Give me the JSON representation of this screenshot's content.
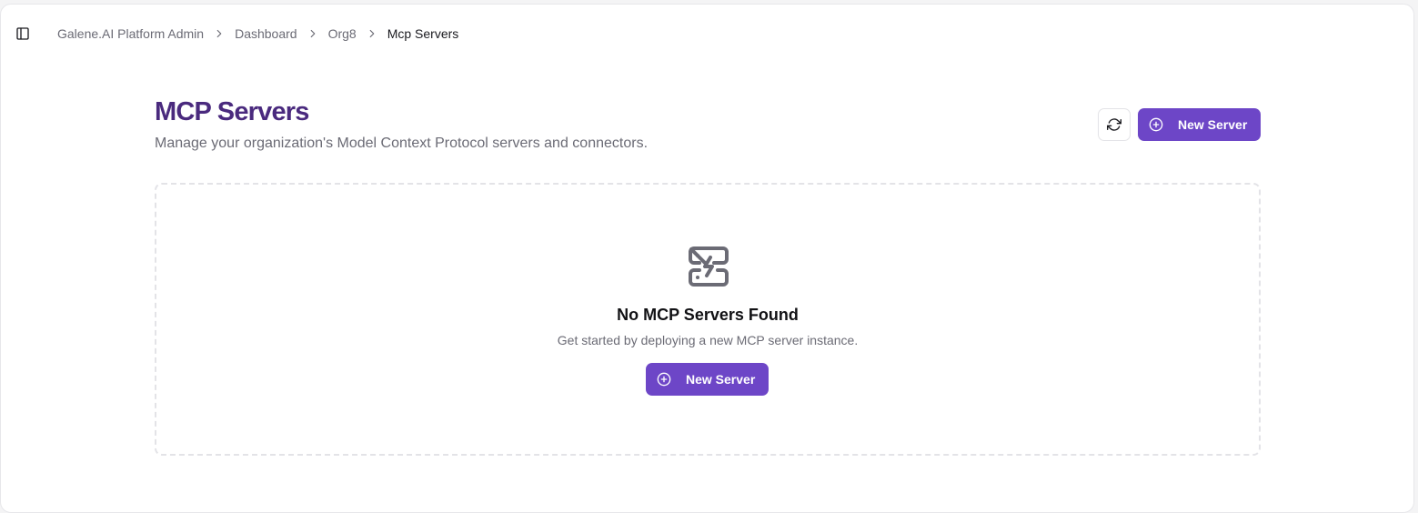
{
  "breadcrumb": {
    "items": [
      "Galene.AI Platform Admin",
      "Dashboard",
      "Org8",
      "Mcp Servers"
    ]
  },
  "header": {
    "title": "MCP Servers",
    "subtitle": "Manage your organization's Model Context Protocol servers and connectors.",
    "new_server_label": "New Server"
  },
  "empty_state": {
    "title": "No MCP Servers Found",
    "description": "Get started by deploying a new MCP server instance.",
    "button_label": "New Server"
  },
  "icons": {
    "sidebar_toggle": "panel-left-icon",
    "separator": "chevron-right-icon",
    "refresh": "refresh-cw-icon",
    "add": "plus-circle-icon",
    "empty": "server-off-icon"
  },
  "colors": {
    "accent": "#6d46c7",
    "title": "#4a2a7e",
    "muted_text": "#6b6b75",
    "border": "#e3e3e7"
  }
}
